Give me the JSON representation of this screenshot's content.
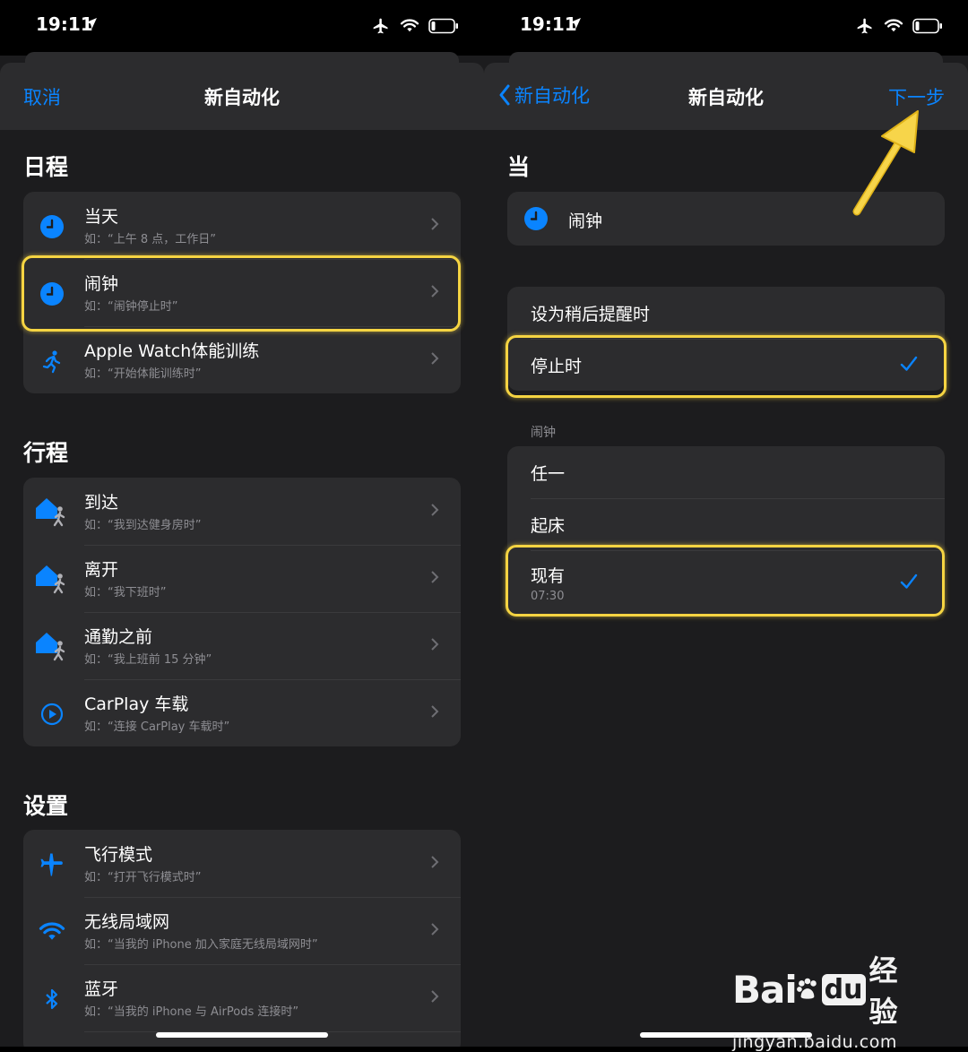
{
  "colors": {
    "accent": "#0a84ff",
    "highlight": "#f5d442",
    "background": "#1c1c1e",
    "card": "#2c2c2e"
  },
  "status_bar": {
    "time": "19:11"
  },
  "left": {
    "nav": {
      "cancel": "取消",
      "title": "新自动化"
    },
    "sections": [
      {
        "header": "日程",
        "items": [
          {
            "title": "当天",
            "subtitle": "如：“上午 8 点，工作日”",
            "icon": "clock-icon"
          },
          {
            "title": "闹钟",
            "subtitle": "如：“闹钟停止时”",
            "icon": "clock-icon"
          },
          {
            "title": "Apple Watch体能训练",
            "subtitle": "如：“开始体能训练时”",
            "icon": "running-figure-icon"
          }
        ]
      },
      {
        "header": "行程",
        "items": [
          {
            "title": "到达",
            "subtitle": "如：“我到达健身房时”",
            "icon": "home-person-icon"
          },
          {
            "title": "离开",
            "subtitle": "如：“我下班时”",
            "icon": "home-person-icon"
          },
          {
            "title": "通勤之前",
            "subtitle": "如：“我上班前 15 分钟”",
            "icon": "home-person-icon"
          },
          {
            "title": "CarPlay 车载",
            "subtitle": "如：“连接 CarPlay 车载时”",
            "icon": "carplay-icon"
          }
        ]
      },
      {
        "header": "设置",
        "items": [
          {
            "title": "飞行模式",
            "subtitle": "如：“打开飞行模式时”",
            "icon": "airplane-icon"
          },
          {
            "title": "无线局域网",
            "subtitle": "如：“当我的 iPhone 加入家庭无线局域网时”",
            "icon": "wifi-icon"
          },
          {
            "title": "蓝牙",
            "subtitle": "如：“当我的 iPhone 与 AirPods 连接时”",
            "icon": "bluetooth-icon"
          }
        ]
      }
    ]
  },
  "right": {
    "nav": {
      "back": "新自动化",
      "title": "新自动化",
      "next": "下一步"
    },
    "section_header": "当",
    "trigger": {
      "label": "闹钟",
      "icon": "clock-icon"
    },
    "event_options": [
      {
        "label": "设为稍后提醒时",
        "checked": false
      },
      {
        "label": "停止时",
        "checked": true
      }
    ],
    "group_label": "闹钟",
    "alarm_options": [
      {
        "label": "任一",
        "checked": false
      },
      {
        "label": "起床",
        "checked": false
      },
      {
        "label": "现有",
        "sub": "07:30",
        "checked": true
      }
    ]
  },
  "watermark": {
    "bai": "Bai",
    "du": "du",
    "jingyan": "经验",
    "url": "jingyan.baidu.com"
  }
}
